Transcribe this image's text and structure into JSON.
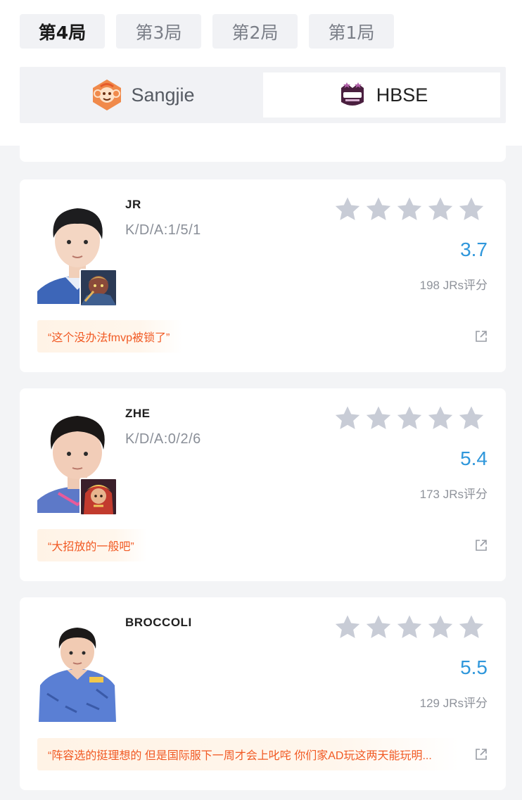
{
  "game_tabs": [
    {
      "label": "第4局",
      "active": true
    },
    {
      "label": "第3局",
      "active": false
    },
    {
      "label": "第2局",
      "active": false
    },
    {
      "label": "第1局",
      "active": false
    }
  ],
  "teams": {
    "left": {
      "name": "Sangjie",
      "logo": "monkey-logo",
      "selected": false
    },
    "right": {
      "name": "HBSE",
      "logo": "hbse-logo",
      "selected": true
    }
  },
  "colors": {
    "star_empty": "#c8ccd6",
    "score": "#2f97db",
    "comment_text": "#f15a24",
    "comment_bg": "#fff3e6"
  },
  "players": [
    {
      "name": "JR",
      "kda": "K/D/A:1/5/1",
      "stars_filled": 0,
      "score": "3.7",
      "rating_count": "198 JRs评分",
      "comment": "“这个没办法fmvp被锁了”",
      "hero_icon": "hero-portrait-icon"
    },
    {
      "name": "ZHE",
      "kda": "K/D/A:0/2/6",
      "stars_filled": 0,
      "score": "5.4",
      "rating_count": "173 JRs评分",
      "comment": "“大招放的一般吧”",
      "hero_icon": "hero-portrait-icon"
    },
    {
      "name": "BROCCOLI",
      "kda": "",
      "stars_filled": 0,
      "score": "5.5",
      "rating_count": "129 JRs评分",
      "comment": "“阵容选的挺理想的 但是国际服下一周才会上叱咤 你们家AD玩这两天能玩明...",
      "hero_icon": ""
    }
  ]
}
